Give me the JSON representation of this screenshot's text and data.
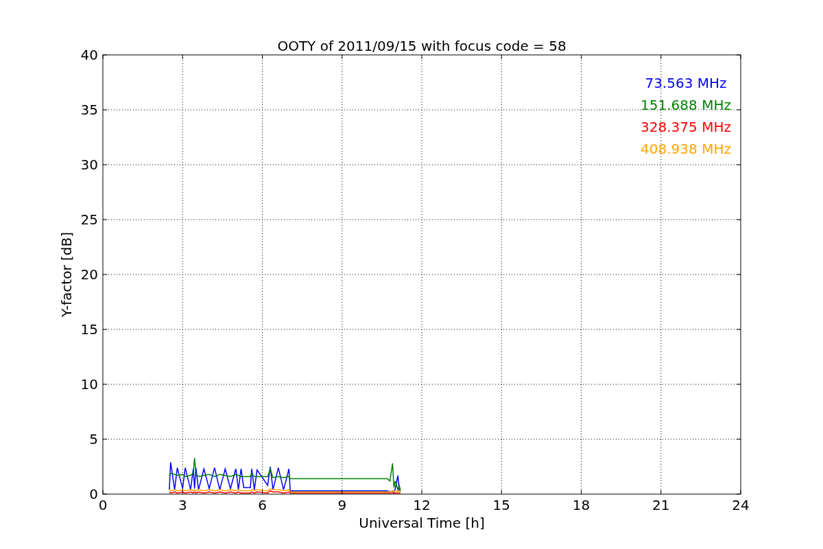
{
  "chart_data": {
    "type": "line",
    "title": "OOTY of 2011/09/15 with focus code = 58",
    "xlabel": "Universal Time [h]",
    "ylabel": "Y-factor [dB]",
    "x": [
      2.5,
      2.55,
      2.7,
      2.8,
      3.0,
      3.1,
      3.3,
      3.4,
      3.45,
      3.5,
      3.6,
      3.8,
      4.0,
      4.2,
      4.4,
      4.6,
      4.8,
      5.0,
      5.1,
      5.2,
      5.3,
      5.55,
      5.6,
      5.7,
      5.8,
      6.2,
      6.3,
      6.4,
      6.6,
      6.8,
      7.0,
      7.05,
      10.7,
      10.8,
      10.9,
      10.95,
      11.0,
      11.1,
      11.15,
      11.2
    ],
    "series": [
      {
        "name": "73.563 MHz",
        "color": "#0000ff",
        "values": [
          0.4,
          2.9,
          0.4,
          2.4,
          0.5,
          2.4,
          0.4,
          2.3,
          0.5,
          2.4,
          0.4,
          2.3,
          0.5,
          2.4,
          0.4,
          2.3,
          0.5,
          2.3,
          0.4,
          2.3,
          0.6,
          0.6,
          2.3,
          0.4,
          2.2,
          0.8,
          2.5,
          0.4,
          2.4,
          0.4,
          2.3,
          0.3,
          0.3,
          0.2,
          0.3,
          0.1,
          0.5,
          1.7,
          0.3,
          0.2
        ]
      },
      {
        "name": "151.688 MHz",
        "color": "#008000",
        "values": [
          1.7,
          1.9,
          1.8,
          1.7,
          1.8,
          1.6,
          1.7,
          1.9,
          3.3,
          1.8,
          1.6,
          1.7,
          1.8,
          1.6,
          1.8,
          1.7,
          1.6,
          1.8,
          1.7,
          1.6,
          1.6,
          1.6,
          1.9,
          1.6,
          1.6,
          1.6,
          2.3,
          1.5,
          1.6,
          1.5,
          1.6,
          1.4,
          1.4,
          1.2,
          2.8,
          0.6,
          1.2,
          0.4,
          0.8,
          0.3
        ]
      },
      {
        "name": "328.375 MHz",
        "color": "#ff0000",
        "values": [
          0.2,
          0.1,
          0.2,
          0.1,
          0.2,
          0.1,
          0.2,
          0.1,
          0.2,
          0.1,
          0.2,
          0.1,
          0.2,
          0.1,
          0.2,
          0.1,
          0.2,
          0.1,
          0.2,
          0.1,
          0.1,
          0.1,
          0.2,
          0.1,
          0.2,
          0.1,
          0.3,
          0.2,
          0.2,
          0.1,
          0.2,
          0.1,
          0.1,
          0.1,
          0.1,
          0.1,
          0.1,
          0.1,
          0.1,
          0.1
        ]
      },
      {
        "name": "408.938 MHz",
        "color": "#ffa500",
        "values": [
          0.4,
          0.3,
          0.4,
          0.3,
          0.4,
          0.3,
          0.4,
          0.3,
          0.4,
          0.3,
          0.4,
          0.3,
          0.4,
          0.3,
          0.4,
          0.3,
          0.4,
          0.3,
          0.4,
          0.3,
          0.3,
          0.3,
          0.4,
          0.3,
          0.4,
          0.3,
          0.5,
          0.4,
          0.4,
          0.3,
          0.4,
          0.2,
          0.2,
          0.2,
          0.3,
          0.2,
          0.3,
          0.2,
          0.3,
          0.2
        ]
      }
    ],
    "xlim": [
      0,
      24
    ],
    "ylim": [
      0,
      40
    ],
    "xticks": [
      0,
      3,
      6,
      9,
      12,
      15,
      18,
      21,
      24
    ],
    "yticks": [
      0,
      5,
      10,
      15,
      20,
      25,
      30,
      35,
      40
    ],
    "grid": true
  }
}
